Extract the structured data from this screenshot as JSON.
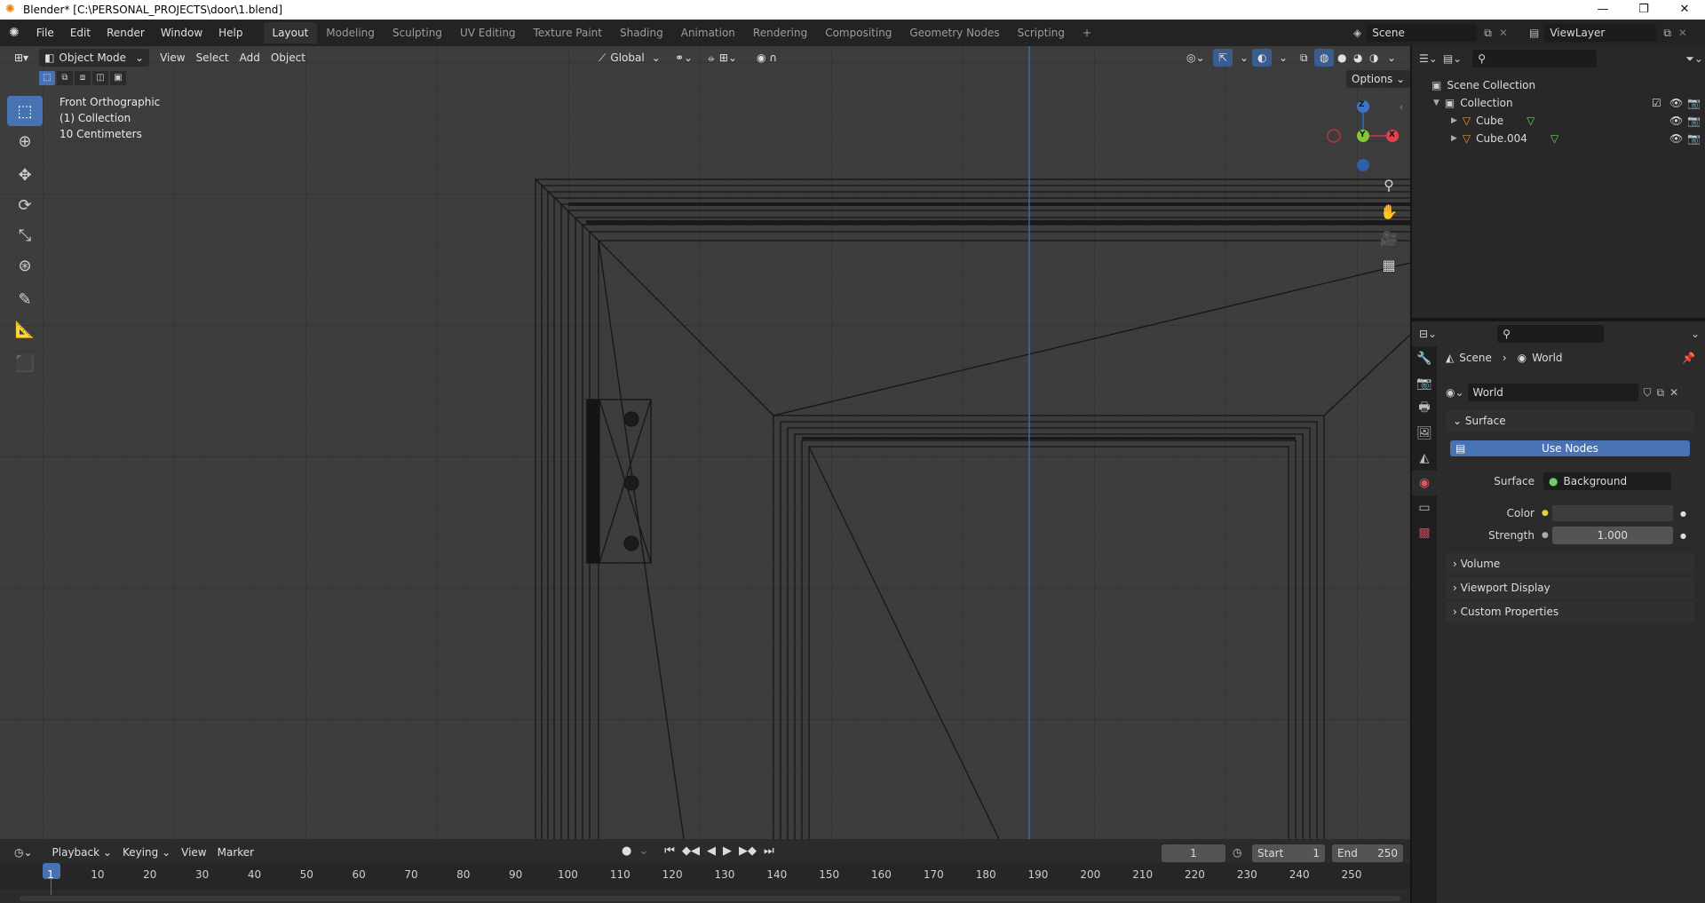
{
  "window": {
    "title": "Blender* [C:\\PERSONAL_PROJECTS\\door\\1.blend]",
    "controls": [
      "minimize-icon",
      "restore-icon",
      "close-icon"
    ]
  },
  "topbar": {
    "menus": [
      "File",
      "Edit",
      "Render",
      "Window",
      "Help"
    ],
    "workspaces": [
      "Layout",
      "Modeling",
      "Sculpting",
      "UV Editing",
      "Texture Paint",
      "Shading",
      "Animation",
      "Rendering",
      "Compositing",
      "Geometry Nodes",
      "Scripting"
    ],
    "active_workspace": "Layout",
    "scene": "Scene",
    "view_layer": "ViewLayer"
  },
  "viewport": {
    "mode": "Object Mode",
    "menus": [
      "View",
      "Select",
      "Add",
      "Object"
    ],
    "orientation": "Global",
    "options_label": "Options",
    "overlay": {
      "view_name": "Front Orthographic",
      "collection": "(1) Collection",
      "scale": "10 Centimeters"
    },
    "gizmo": {
      "z": "Z",
      "y": "Y",
      "x": "X"
    },
    "tools": [
      "select-box-icon",
      "cursor-icon",
      "move-icon",
      "rotate-icon",
      "scale-icon",
      "transform-icon",
      "annotate-icon",
      "measure-icon",
      "add-cube-icon"
    ]
  },
  "outliner": {
    "search_placeholder": "",
    "root": "Scene Collection",
    "collection": "Collection",
    "objects": [
      "Cube",
      "Cube.004"
    ]
  },
  "properties": {
    "breadcrumb": [
      "Scene",
      "World"
    ],
    "world_name": "World",
    "surface_panel": "Surface",
    "use_nodes": "Use Nodes",
    "surface_label": "Surface",
    "surface_value": "Background",
    "color_label": "Color",
    "strength_label": "Strength",
    "strength_value": "1.000",
    "collapsed_panels": [
      "Volume",
      "Viewport Display",
      "Custom Properties"
    ],
    "colors": {
      "accent": "#4772b3"
    }
  },
  "timeline": {
    "menus": [
      "Playback",
      "Keying",
      "View",
      "Marker"
    ],
    "current_frame": "1",
    "start_label": "Start",
    "start_value": "1",
    "end_label": "End",
    "end_value": "250",
    "ticks": [
      "1",
      "10",
      "20",
      "30",
      "40",
      "50",
      "60",
      "70",
      "80",
      "90",
      "100",
      "110",
      "120",
      "130",
      "140",
      "150",
      "160",
      "170",
      "180",
      "190",
      "200",
      "210",
      "220",
      "230",
      "240",
      "250"
    ]
  }
}
